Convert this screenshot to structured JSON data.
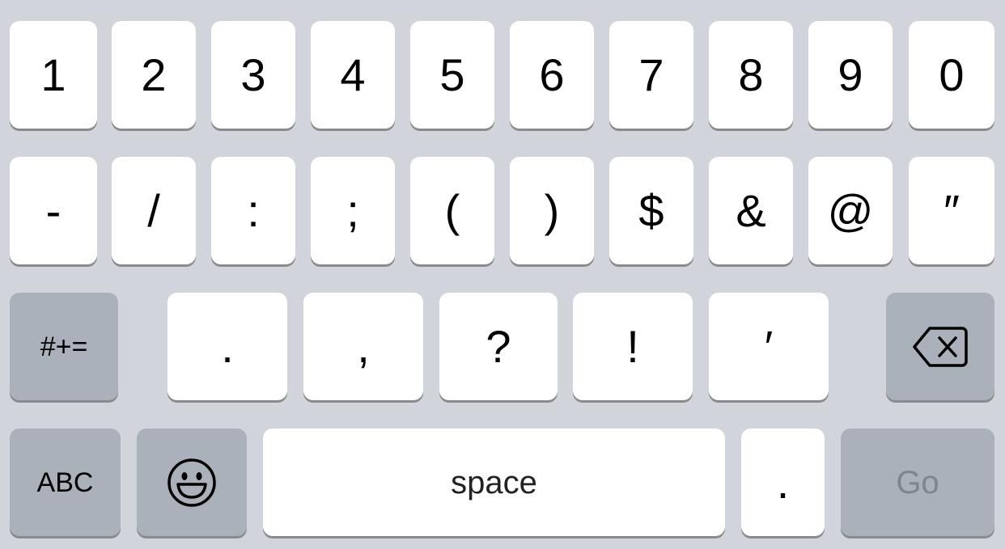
{
  "row1": [
    "1",
    "2",
    "3",
    "4",
    "5",
    "6",
    "7",
    "8",
    "9",
    "0"
  ],
  "row2": [
    "-",
    "/",
    ":",
    ";",
    "(",
    ")",
    "$",
    "&",
    "@",
    "″"
  ],
  "row3": {
    "shift_label": "#+=",
    "keys": [
      ".",
      ",",
      "?",
      "!",
      "′"
    ],
    "delete_icon": "backspace-icon"
  },
  "row4": {
    "abc_label": "ABC",
    "emoji_icon": "emoji-icon",
    "space_label": "space",
    "period_label": ".",
    "go_label": "Go"
  },
  "colors": {
    "background": "#d1d5db",
    "key_light": "#ffffff",
    "key_dark": "#abb1ba",
    "go_text": "#7f858e"
  }
}
